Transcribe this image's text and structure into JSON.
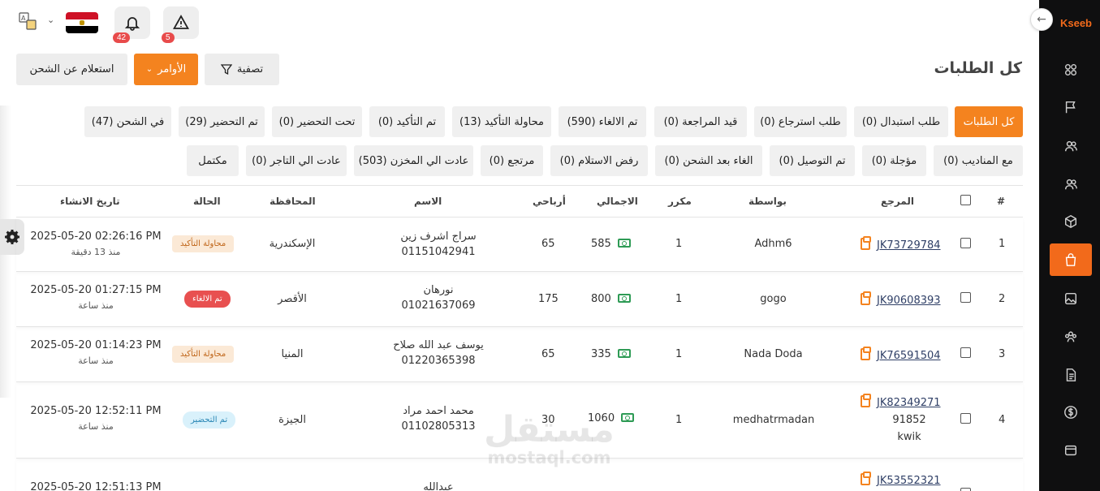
{
  "brand": {
    "logo_text": "Kseeb",
    "accent": "#f4831f"
  },
  "topbar": {
    "alerts_badge": "5",
    "notifications_badge": "42",
    "language_icon": "translate-icon"
  },
  "header": {
    "title": "كل الطلبات",
    "filter_label": "تصفية",
    "commands_label": "الأوامر",
    "inquiry_label": "استعلام عن الشحن"
  },
  "status_filters": [
    "كل الطلبات",
    "طلب استبدال (0)",
    "طلب استرجاع (0)",
    "قيد المراجعة (0)",
    "تم الالغاء (590)",
    "محاولة التأكيد (13)",
    "تم التأكيد (0)",
    "تحت التحضير (0)",
    "تم التحضير (29)",
    "في الشحن (47)",
    "مع المناديب (0)",
    "مؤجلة (0)",
    "تم التوصيل (0)",
    "الغاء بعد الشحن (0)",
    "رفض الاستلام (0)",
    "مرتجع (0)",
    "عادت الي المخزن (503)",
    "عادت الي التاجر (0)",
    "مكتمل"
  ],
  "table": {
    "headers": {
      "num": "#",
      "ref": "المرجع",
      "via": "بواسطة",
      "dup": "مكرر",
      "total": "الاجمالي",
      "profit": "أرباحي",
      "name": "الاسم",
      "governorate": "المحافظة",
      "status": "الحالة",
      "created": "تاريخ الانشاء"
    },
    "rows": [
      {
        "num": "1",
        "ref": "JK73729784",
        "ref_extra": "",
        "ref_extra2": "",
        "via": "Adhm6",
        "dup": "1",
        "total": "585",
        "profit": "65",
        "name": "سراج اشرف زين",
        "phone": "01151042941",
        "governorate": "الإسكندرية",
        "status": "محاولة التأكيد",
        "date": "2025-05-20 02:26:16 PM",
        "ago": "منذ 13 دقيقة"
      },
      {
        "num": "2",
        "ref": "JK90608393",
        "ref_extra": "",
        "ref_extra2": "",
        "via": "gogo",
        "dup": "1",
        "total": "800",
        "profit": "175",
        "name": "نورهان",
        "phone": "01021637069",
        "governorate": "الأقصر",
        "status": "تم الالغاء",
        "date": "2025-05-20 01:27:15 PM",
        "ago": "منذ ساعة"
      },
      {
        "num": "3",
        "ref": "JK76591504",
        "ref_extra": "",
        "ref_extra2": "",
        "via": "Nada Doda",
        "dup": "1",
        "total": "335",
        "profit": "65",
        "name": "يوسف عبد الله صلاح",
        "phone": "01220365398",
        "governorate": "المنيا",
        "status": "محاولة التأكيد",
        "date": "2025-05-20 01:14:23 PM",
        "ago": "منذ ساعة"
      },
      {
        "num": "4",
        "ref": "JK82349271",
        "ref_extra": "91852",
        "ref_extra2": "kwik",
        "via": "medhatrmadan",
        "dup": "1",
        "total": "1060",
        "profit": "30",
        "name": "محمد احمد مراد",
        "phone": "01102805313",
        "governorate": "الجيزة",
        "status": "تم التحضير",
        "date": "2025-05-20 12:52:11 PM",
        "ago": "منذ ساعة"
      },
      {
        "num": "5",
        "ref": "JK53552321",
        "ref_extra": "",
        "ref_extra2": "",
        "via": "",
        "dup": "",
        "total": "",
        "profit": "",
        "name": "عبدالله",
        "phone": "",
        "governorate": "",
        "status": "",
        "date": "2025-05-20 12:51:13 PM",
        "ago": ""
      }
    ]
  },
  "watermark": {
    "arabic": "مستقل",
    "latin": "mostaql.com"
  }
}
